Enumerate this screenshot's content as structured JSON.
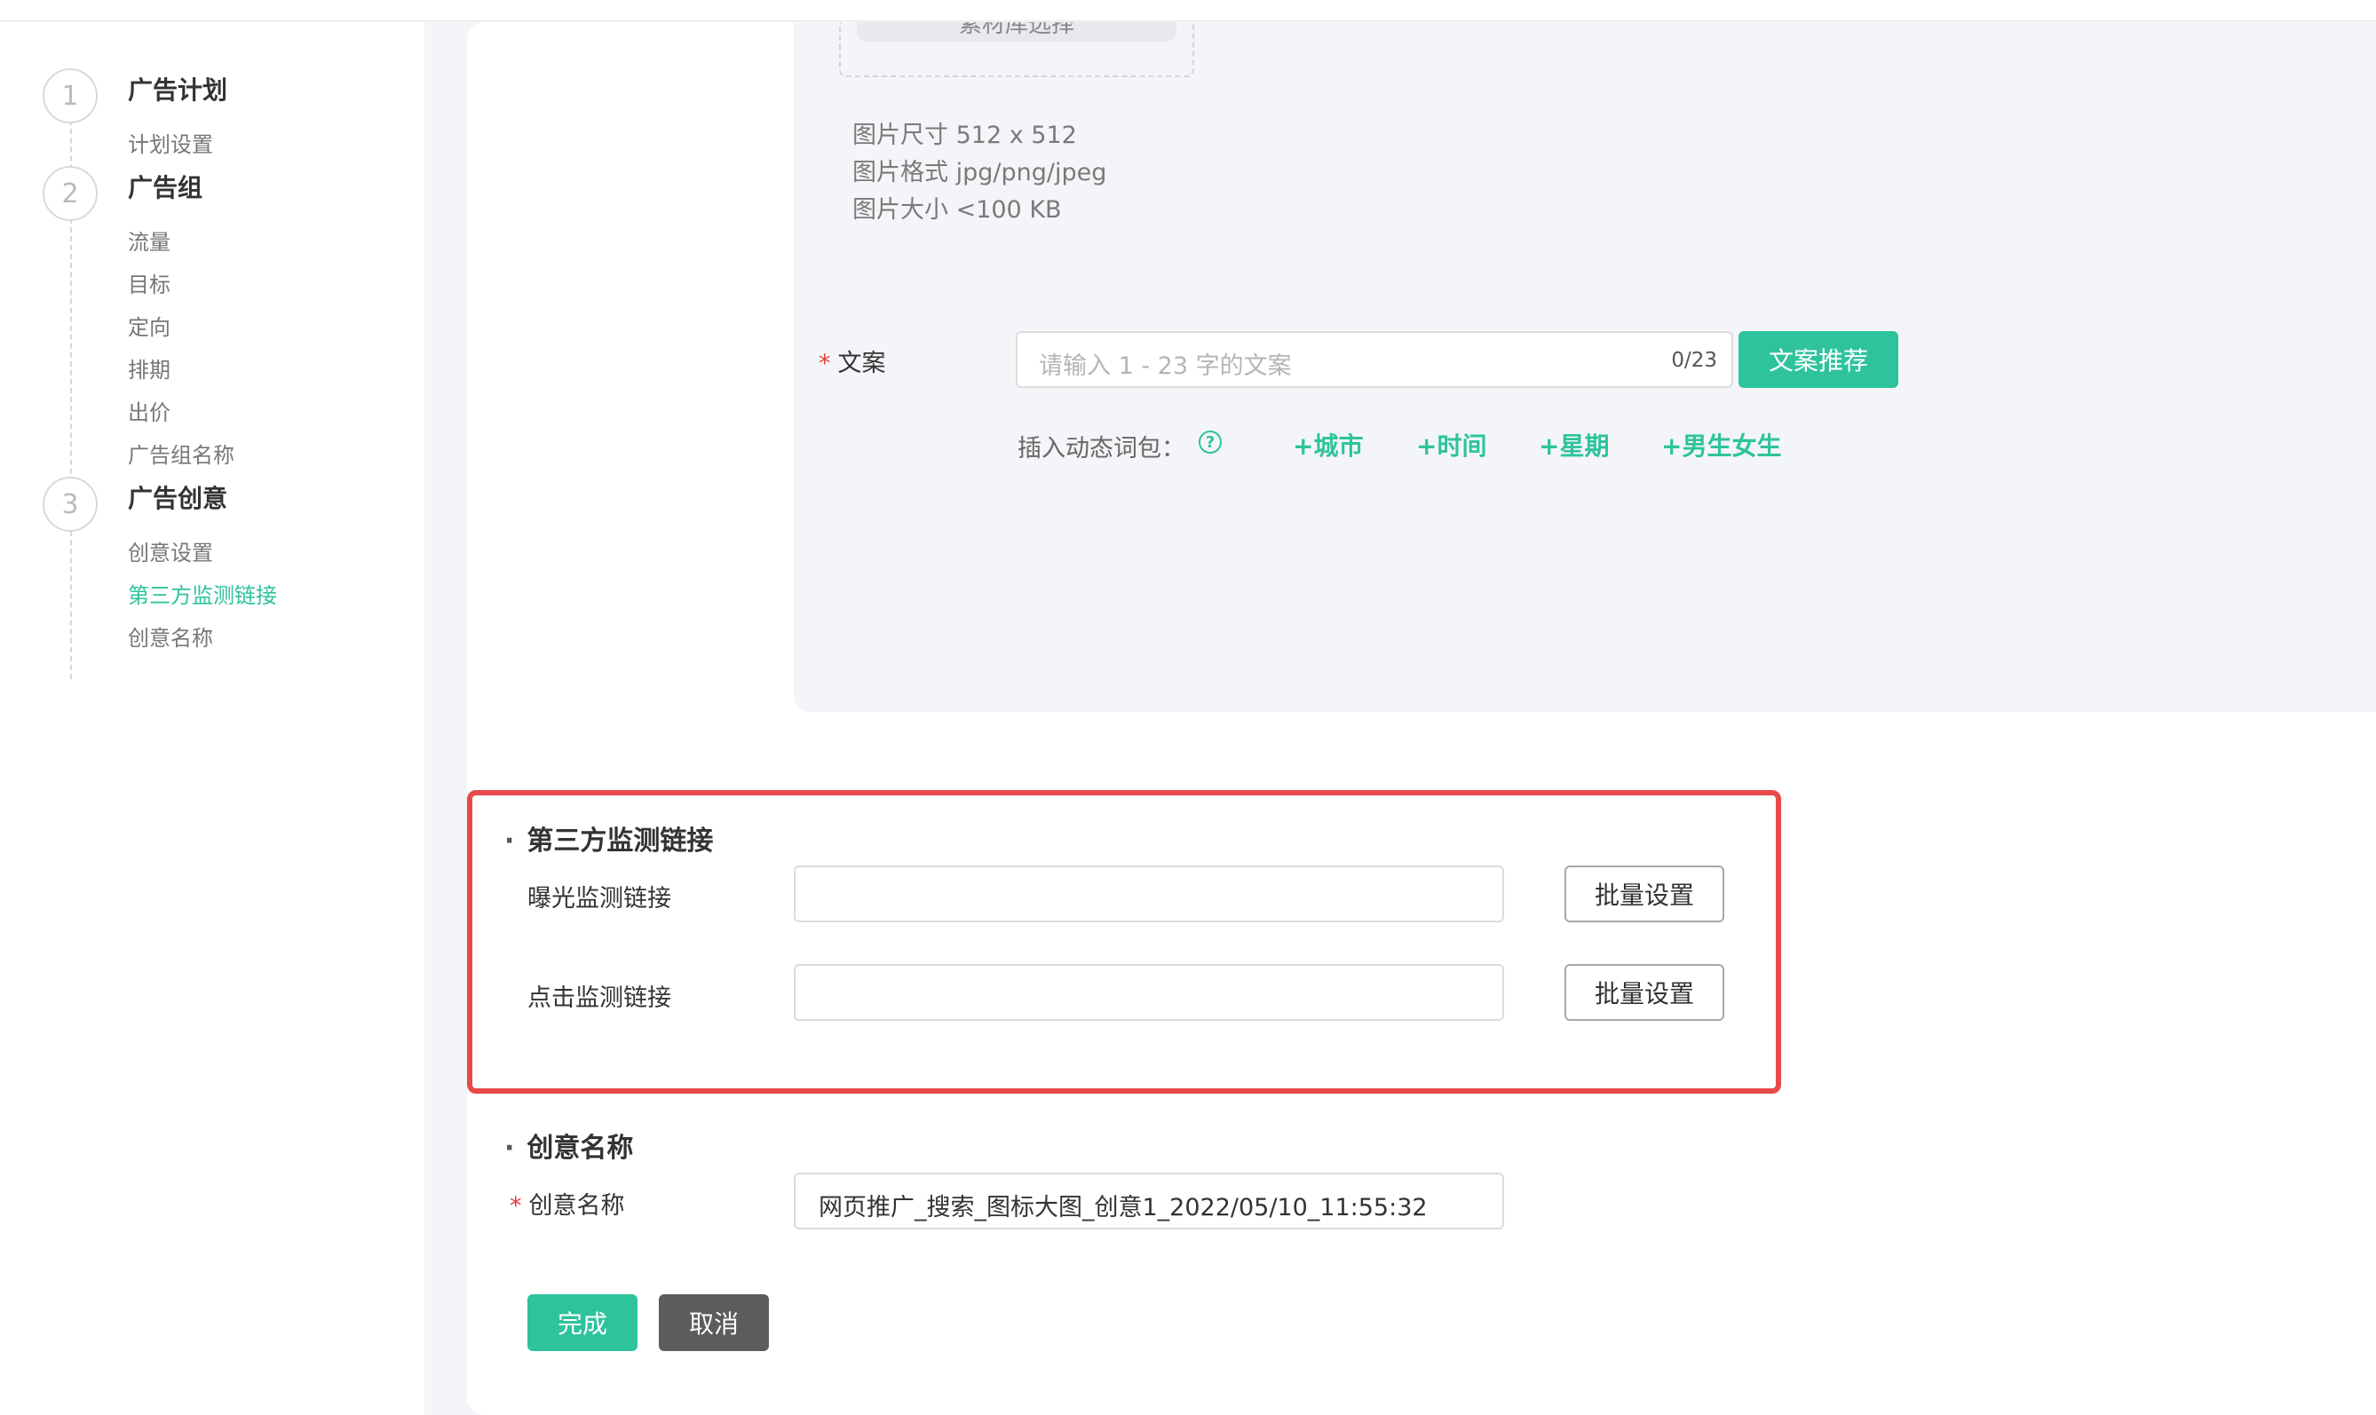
{
  "sidebar": {
    "steps": [
      {
        "number": "1",
        "title": "广告计划",
        "subs": [
          "计划设置"
        ]
      },
      {
        "number": "2",
        "title": "广告组",
        "subs": [
          "流量",
          "目标",
          "定向",
          "排期",
          "出价",
          "广告组名称"
        ]
      },
      {
        "number": "3",
        "title": "广告创意",
        "subs": [
          "创意设置",
          "第三方监测链接",
          "创意名称"
        ]
      }
    ]
  },
  "upload": {
    "button_label": "素材库选择",
    "info": [
      "图片尺寸 512 x 512",
      "图片格式 jpg/png/jpeg",
      "图片大小 <100 KB"
    ]
  },
  "copy_field": {
    "required_mark": "*",
    "label": "文案",
    "placeholder": "请输入 1 - 23 字的文案",
    "count": "0/23",
    "recommend_button": "文案推荐"
  },
  "dynamic_words": {
    "label": "插入动态词包：",
    "help_icon": "question-circle-icon",
    "tags": [
      "+城市",
      "+时间",
      "+星期",
      "+男生女生"
    ]
  },
  "monitor_section": {
    "dot": "·",
    "title": "第三方监测链接",
    "impression_label": "曝光监测链接",
    "impression_value": "",
    "click_label": "点击监测链接",
    "click_value": "",
    "batch_button": "批量设置"
  },
  "name_section": {
    "dot": "·",
    "title": "创意名称",
    "required_mark": "*",
    "label": "创意名称",
    "value": "网页推广_搜索_图标大图_创意1_2022/05/10_11:55:32"
  },
  "actions": {
    "done": "完成",
    "cancel": "取消"
  },
  "colors": {
    "accent": "#2ec39d",
    "highlight": "#e84a4a",
    "required": "#e53c3c"
  }
}
